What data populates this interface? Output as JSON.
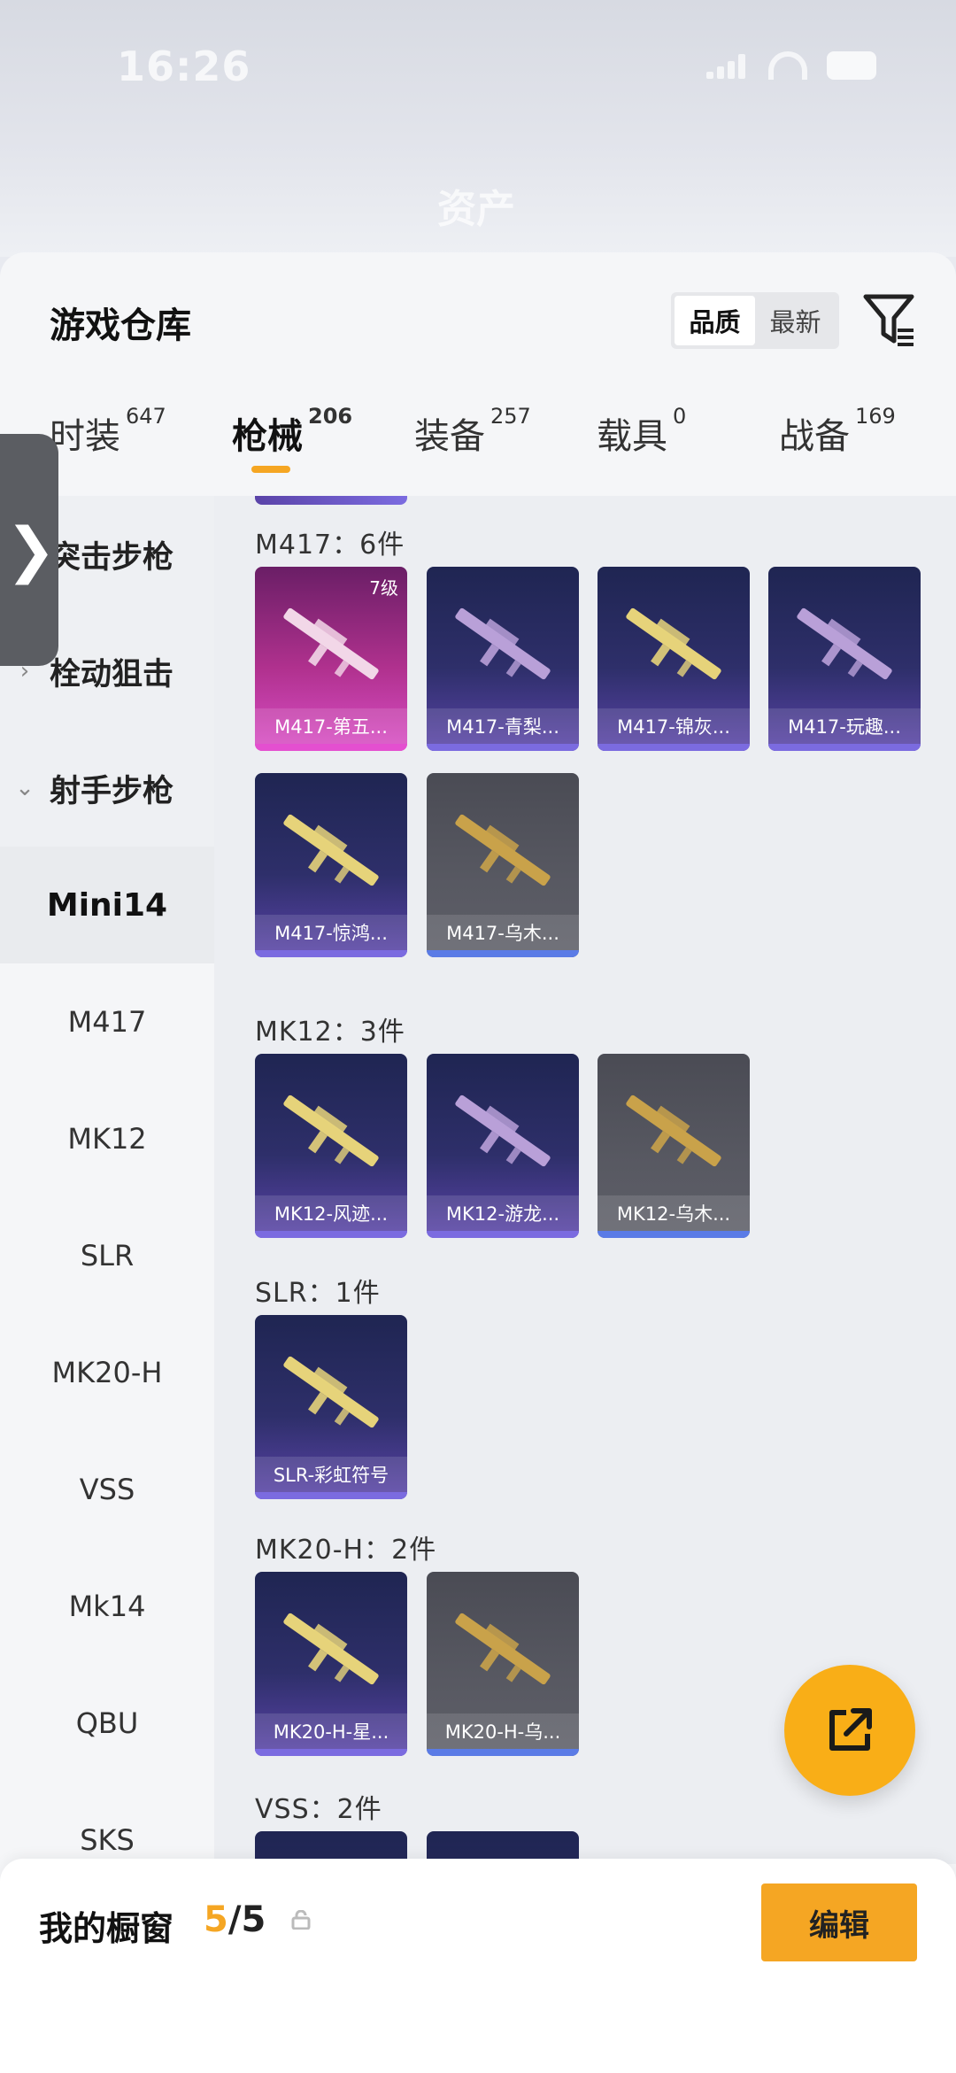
{
  "status_bar": {
    "time": "16:26"
  },
  "header": {
    "blurred_title": "资产"
  },
  "sheet": {
    "title": "游戏仓库",
    "sort": {
      "quality": "品质",
      "newest": "最新",
      "selected": "quality"
    }
  },
  "tabs": [
    {
      "label": "时装",
      "count": "647"
    },
    {
      "label": "枪械",
      "count": "206"
    },
    {
      "label": "装备",
      "count": "257"
    },
    {
      "label": "载具",
      "count": "0"
    },
    {
      "label": "战备",
      "count": "169"
    }
  ],
  "sidebar": {
    "categories": [
      {
        "label": "突击步枪",
        "chevron": "›"
      },
      {
        "label": "栓动狙击",
        "chevron": "›"
      },
      {
        "label": "射手步枪",
        "chevron": "⌄"
      }
    ],
    "subs": [
      "Mini14",
      "M417",
      "MK12",
      "SLR",
      "MK20-H",
      "VSS",
      "Mk14",
      "QBU",
      "SKS"
    ],
    "selected_sub": "Mini14"
  },
  "groups": [
    {
      "title": "M417：6件",
      "items": [
        {
          "name": "M417-第五...",
          "rarity": "pink",
          "level": "7级"
        },
        {
          "name": "M417-青梨...",
          "rarity": "purple"
        },
        {
          "name": "M417-锦灰...",
          "rarity": "purple"
        },
        {
          "name": "M417-玩趣...",
          "rarity": "purple"
        },
        {
          "name": "M417-惊鸿...",
          "rarity": "purple"
        },
        {
          "name": "M417-乌木...",
          "rarity": "grey"
        }
      ]
    },
    {
      "title": "MK12：3件",
      "items": [
        {
          "name": "MK12-风迹...",
          "rarity": "purple"
        },
        {
          "name": "MK12-游龙...",
          "rarity": "purple"
        },
        {
          "name": "MK12-乌木...",
          "rarity": "grey"
        }
      ]
    },
    {
      "title": "SLR：1件",
      "items": [
        {
          "name": "SLR-彩虹符号",
          "rarity": "purple"
        }
      ]
    },
    {
      "title": "MK20-H：2件",
      "items": [
        {
          "name": "MK20-H-星...",
          "rarity": "purple"
        },
        {
          "name": "MK20-H-乌...",
          "rarity": "grey"
        }
      ]
    },
    {
      "title": "VSS：2件",
      "items": []
    }
  ],
  "bottom": {
    "label": "我的橱窗",
    "count_current": "5",
    "count_sep": "/5",
    "edit": "编辑"
  },
  "colors": {
    "accent": "#f5a623",
    "fab": "#f9ae17"
  },
  "icons": {
    "filter": "filter-icon",
    "share": "share-external-icon",
    "lock": "lock-icon"
  }
}
